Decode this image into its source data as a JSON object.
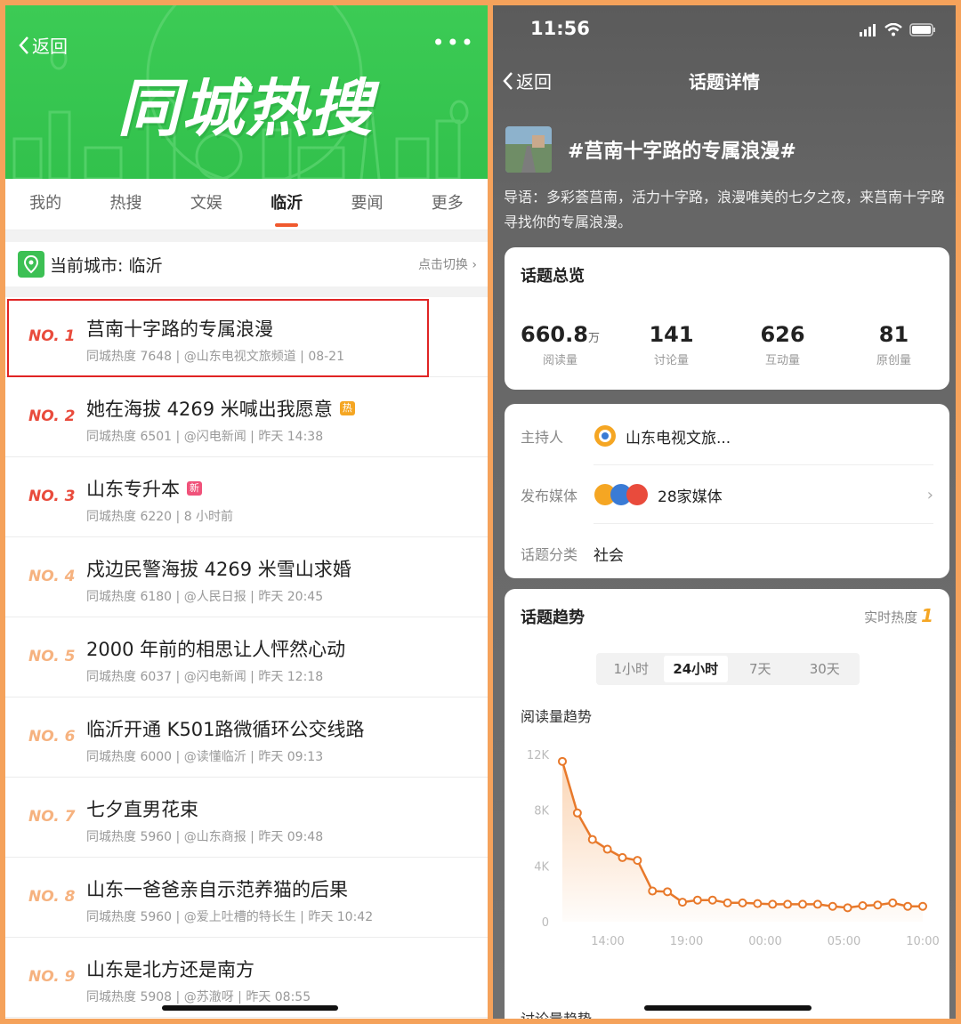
{
  "left": {
    "back_label": "返回",
    "more_label": "•••",
    "banner_title": "同城热搜",
    "tabs": [
      {
        "label": "我的",
        "active": false
      },
      {
        "label": "热搜",
        "active": false
      },
      {
        "label": "文娱",
        "active": false
      },
      {
        "label": "临沂",
        "active": true
      },
      {
        "label": "要闻",
        "active": false
      },
      {
        "label": "更多",
        "active": false
      }
    ],
    "city": {
      "label": "当前城市: 临沂",
      "switch": "点击切换 ›"
    },
    "items": [
      {
        "no": "NO. 1",
        "title": "莒南十字路的专属浪漫",
        "meta": "同城热度 7648 | @山东电视文旅频道 | 08-21",
        "badge": "",
        "badge_type": ""
      },
      {
        "no": "NO. 2",
        "title": "她在海拔 4269 米喊出我愿意",
        "meta": "同城热度 6501 | @闪电新闻 | 昨天 14:38",
        "badge": "热",
        "badge_type": "hot"
      },
      {
        "no": "NO. 3",
        "title": "山东专升本",
        "meta": "同城热度 6220 | 8 小时前",
        "badge": "新",
        "badge_type": "new"
      },
      {
        "no": "NO. 4",
        "title": "戍边民警海拔 4269 米雪山求婚",
        "meta": "同城热度 6180 | @人民日报 | 昨天 20:45",
        "badge": "",
        "badge_type": ""
      },
      {
        "no": "NO. 5",
        "title": "2000 年前的相思让人怦然心动",
        "meta": "同城热度 6037 | @闪电新闻 | 昨天 12:18",
        "badge": "",
        "badge_type": ""
      },
      {
        "no": "NO. 6",
        "title": "临沂开通 K501路微循环公交线路",
        "meta": "同城热度 6000 | @读懂临沂 | 昨天 09:13",
        "badge": "",
        "badge_type": ""
      },
      {
        "no": "NO. 7",
        "title": "七夕直男花束",
        "meta": "同城热度 5960 | @山东商报 | 昨天 09:48",
        "badge": "",
        "badge_type": ""
      },
      {
        "no": "NO. 8",
        "title": "山东一爸爸亲自示范养猫的后果",
        "meta": "同城热度 5960 | @爱上吐槽的特长生 | 昨天 10:42",
        "badge": "",
        "badge_type": ""
      },
      {
        "no": "NO. 9",
        "title": "山东是北方还是南方",
        "meta": "同城热度 5908 | @苏澈呀 | 昨天 08:55",
        "badge": "",
        "badge_type": ""
      }
    ]
  },
  "right": {
    "time": "11:56",
    "back_label": "返回",
    "page_title": "话题详情",
    "topic": "#莒南十字路的专属浪漫#",
    "intro": "导语：多彩荟莒南，活力十字路，浪漫唯美的七夕之夜，来莒南十字路寻找你的专属浪漫。",
    "overview": {
      "title": "话题总览",
      "stats": [
        {
          "value": "660.8",
          "unit": "万",
          "label": "阅读量"
        },
        {
          "value": "141",
          "unit": "",
          "label": "讨论量"
        },
        {
          "value": "626",
          "unit": "",
          "label": "互动量"
        },
        {
          "value": "81",
          "unit": "",
          "label": "原创量"
        }
      ]
    },
    "info": {
      "host_key": "主持人",
      "host_val": "山东电视文旅...",
      "media_key": "发布媒体",
      "media_val": "28家媒体",
      "cat_key": "话题分类",
      "cat_val": "社会"
    },
    "trend": {
      "title": "话题趋势",
      "hot_label": "实时热度",
      "hot_value": "1",
      "ranges": [
        {
          "label": "1小时",
          "on": false
        },
        {
          "label": "24小时",
          "on": true
        },
        {
          "label": "7天",
          "on": false
        },
        {
          "label": "30天",
          "on": false
        }
      ],
      "chart_title": "阅读量趋势",
      "next_title": "讨论量趋势"
    },
    "colors": {
      "line": "#e8792b",
      "accent": "#f5a623"
    }
  },
  "chart_data": {
    "type": "line",
    "title": "阅读量趋势",
    "xlabel": "",
    "ylabel": "",
    "y_ticks": [
      "12K",
      "8K",
      "4K",
      "0"
    ],
    "ylim": [
      0,
      12000
    ],
    "x_ticks": [
      "14:00",
      "19:00",
      "00:00",
      "05:00",
      "10:00"
    ],
    "series": [
      {
        "values": [
          11500,
          7800,
          5900,
          5200,
          4600,
          4400,
          2200,
          2150,
          1400,
          1550,
          1550,
          1350,
          1350,
          1300,
          1250,
          1250,
          1250,
          1250,
          1100,
          1000,
          1150,
          1200,
          1350,
          1100,
          1100
        ]
      }
    ]
  }
}
